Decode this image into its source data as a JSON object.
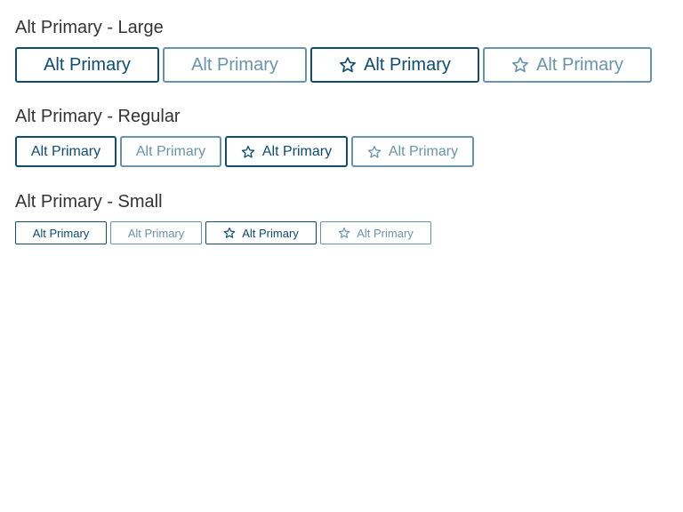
{
  "colors": {
    "accent": "#0f4c6d",
    "accent_disabled": "#6b93aa",
    "heading": "#333333",
    "background": "#ffffff"
  },
  "sections": [
    {
      "title": "Alt Primary - Large",
      "buttons": [
        {
          "label": "Alt Primary",
          "icon": null,
          "state": "enabled"
        },
        {
          "label": "Alt Primary",
          "icon": null,
          "state": "disabled"
        },
        {
          "label": "Alt Primary",
          "icon": "star-icon",
          "state": "enabled"
        },
        {
          "label": "Alt Primary",
          "icon": "star-icon",
          "state": "disabled"
        }
      ]
    },
    {
      "title": "Alt Primary - Regular",
      "buttons": [
        {
          "label": "Alt Primary",
          "icon": null,
          "state": "enabled"
        },
        {
          "label": "Alt Primary",
          "icon": null,
          "state": "disabled"
        },
        {
          "label": "Alt Primary",
          "icon": "star-icon",
          "state": "enabled"
        },
        {
          "label": "Alt Primary",
          "icon": "star-icon",
          "state": "disabled"
        }
      ]
    },
    {
      "title": "Alt Primary - Small",
      "buttons": [
        {
          "label": "Alt Primary",
          "icon": null,
          "state": "enabled"
        },
        {
          "label": "Alt Primary",
          "icon": null,
          "state": "disabled"
        },
        {
          "label": "Alt Primary",
          "icon": "star-icon",
          "state": "enabled"
        },
        {
          "label": "Alt Primary",
          "icon": "star-icon",
          "state": "disabled"
        }
      ]
    }
  ]
}
